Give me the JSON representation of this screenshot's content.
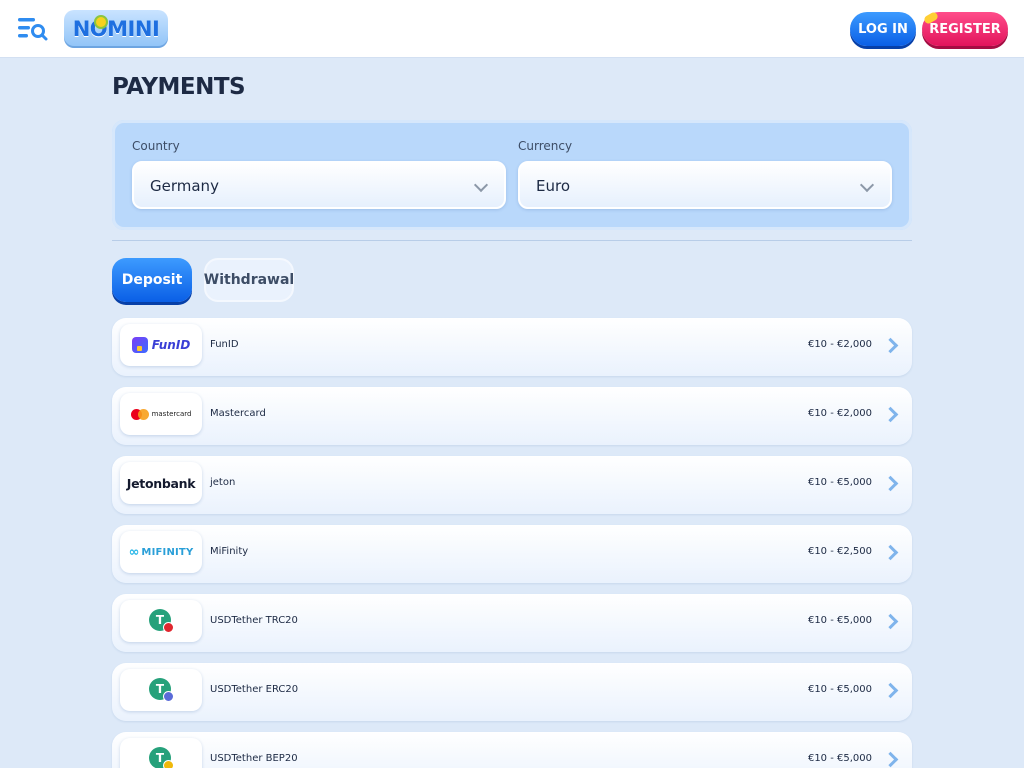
{
  "header": {
    "logo_text": "NOMINI",
    "login_label": "LOG IN",
    "register_label": "REGISTER"
  },
  "page": {
    "title": "PAYMENTS"
  },
  "filters": {
    "country_label": "Country",
    "country_value": "Germany",
    "currency_label": "Currency",
    "currency_value": "Euro"
  },
  "tabs": [
    {
      "label": "Deposit",
      "active": true
    },
    {
      "label": "Withdrawal",
      "active": false
    }
  ],
  "payments": [
    {
      "name": "FunID",
      "logo_text": "FunID",
      "limits": "€10 - €2,000"
    },
    {
      "name": "Mastercard",
      "logo_text": "mastercard",
      "limits": "€10 - €2,000"
    },
    {
      "name": "jeton",
      "logo_text": "Jetonbank",
      "limits": "€10 - €5,000"
    },
    {
      "name": "MiFinity",
      "logo_text": "MIFINITY",
      "limits": "€10 - €2,500"
    },
    {
      "name": "USDTether TRC20",
      "logo_text": "T",
      "limits": "€10 - €5,000"
    },
    {
      "name": "USDTether ERC20",
      "logo_text": "T",
      "limits": "€10 - €5,000"
    },
    {
      "name": "USDTether BEP20",
      "logo_text": "T",
      "limits": "€10 - €5,000"
    }
  ],
  "icons": {
    "menu": "menu-search-icon",
    "chevron": "chevron-down-icon",
    "row_arrow": "chevron-right-icon"
  },
  "colors": {
    "accent_blue": "#0a5fe6",
    "register_pink": "#e2145c",
    "background": "#dde9f8",
    "panel": "#b9d8fb"
  }
}
